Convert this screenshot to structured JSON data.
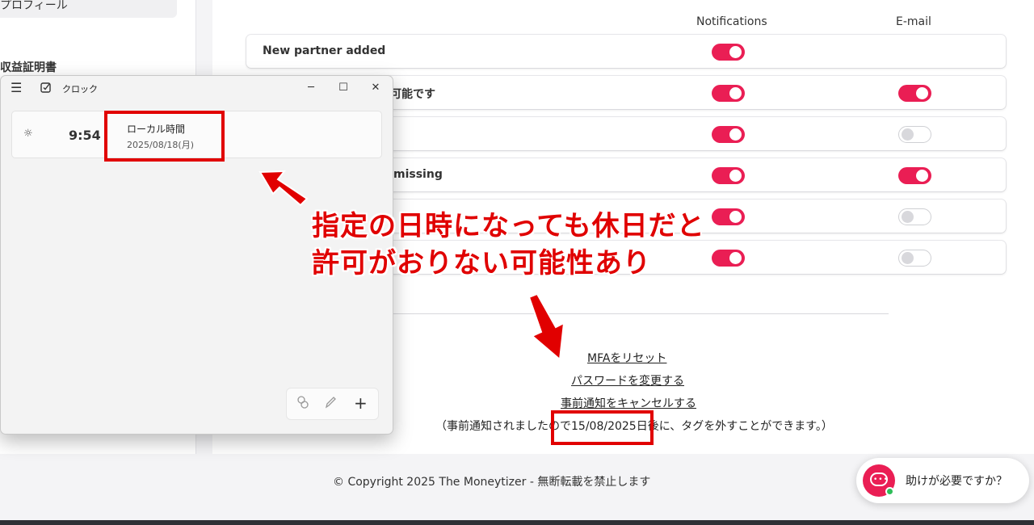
{
  "sidebar": {
    "profile_label": "プロフィール",
    "section_label": "収益証明書"
  },
  "settings": {
    "col_notifications": "Notifications",
    "col_email": "E-mail",
    "rows": [
      {
        "label": "New partner added",
        "notifications": true,
        "email": null
      },
      {
        "label": "可能です",
        "notifications": true,
        "email": true
      },
      {
        "label": "",
        "notifications": true,
        "email": false
      },
      {
        "label": "missing",
        "notifications": true,
        "email": true
      },
      {
        "label": "",
        "notifications": true,
        "email": false
      },
      {
        "label": "",
        "notifications": true,
        "email": false
      }
    ]
  },
  "links": {
    "reset_mfa": "MFAをリセット",
    "change_password": "パスワードを変更する",
    "cancel_notice": "事前通知をキャンセルする"
  },
  "note": {
    "before": "（事前通知されましたので",
    "date": "15/08/2025日後",
    "after": "に、タグを外すことができます。）"
  },
  "footer": {
    "copyright": "© Copyright 2025 The Moneytizer - 無断転載を禁止します"
  },
  "help_widget": {
    "label": "助けが必要ですか？",
    "icon": "chat-bubble-icon"
  },
  "clock_app": {
    "title": "クロック",
    "time": "9:54",
    "timezone": "ローカル時間",
    "date": "2025/08/18(月)",
    "icons": [
      "hamburger-icon",
      "clock-app-icon",
      "minimize-icon",
      "maximize-icon",
      "close-icon",
      "sun-icon",
      "compare-icon",
      "edit-icon",
      "add-icon"
    ]
  },
  "annotation": {
    "line1": "指定の日時になっても休日だと",
    "line2": "許可がおりない可能性あり",
    "color": "#e10000"
  },
  "colors": {
    "accent": "#ea1e54",
    "toggle_off": "#d8d8dc"
  }
}
